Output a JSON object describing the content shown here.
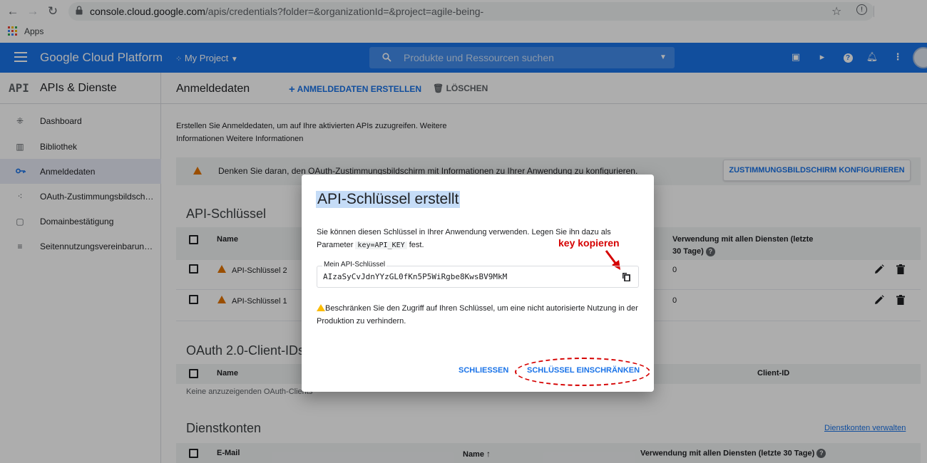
{
  "browser": {
    "url_host": "console.cloud.google.com",
    "url_rest": "/apis/credentials?folder=&organizationId=&project=agile-being-",
    "bookmarks_apps_label": "Apps"
  },
  "topbar": {
    "brand": "Google Cloud Platform",
    "project": "My Project",
    "search_placeholder": "Produkte und Ressourcen suchen"
  },
  "sidebar": {
    "logo": "API",
    "title": "APIs & Dienste",
    "items": [
      {
        "label": "Dashboard",
        "icon": "dashboard-icon"
      },
      {
        "label": "Bibliothek",
        "icon": "library-icon"
      },
      {
        "label": "Anmeldedaten",
        "icon": "key-icon",
        "active": true
      },
      {
        "label": "OAuth-Zustimmungsbildsch…",
        "icon": "consent-icon"
      },
      {
        "label": "Domainbestätigung",
        "icon": "domain-icon"
      },
      {
        "label": "Seitennutzungsvereinbarun…",
        "icon": "settings-list-icon"
      }
    ]
  },
  "main": {
    "title": "Anmeldedaten",
    "create_label": "ANMELDEDATEN ERSTELLEN",
    "delete_label": "LÖSCHEN",
    "intro": "Erstellen Sie Anmeldedaten, um auf Ihre aktivierten APIs zuzugreifen. Weitere Informationen Weitere Informationen",
    "warning": "Denken Sie daran, den OAuth-Zustimmungsbildschirm mit Informationen zu Ihrer Anwendung zu konfigurieren.",
    "consent_button": "ZUSTIMMUNGSBILDSCHIRM KONFIGURIEREN",
    "api_keys": {
      "title": "API-Schlüssel",
      "col_name": "Name",
      "col_usage": "Verwendung mit allen Diensten (letzte 30 Tage)",
      "rows": [
        {
          "name": "API-Schlüssel 2",
          "usage": "0"
        },
        {
          "name": "API-Schlüssel 1",
          "usage": "0"
        }
      ]
    },
    "oauth": {
      "title": "OAuth 2.0-Client-IDs",
      "col_name": "Name",
      "col_client": "Client-ID",
      "empty": "Keine anzuzeigenden OAuth-Clients"
    },
    "service_accounts": {
      "title": "Dienstkonten",
      "manage_link": "Dienstkonten verwalten",
      "col_email": "E-Mail",
      "col_name": "Name",
      "col_usage": "Verwendung mit allen Diensten (letzte 30 Tage)"
    }
  },
  "dialog": {
    "title": "API-Schlüssel erstellt",
    "text_before": "Sie können diesen Schlüssel in Ihrer Anwendung verwenden. Legen Sie ihn dazu als Parameter",
    "param": "key=API_KEY",
    "text_after": "fest.",
    "key_label": "Mein API-Schlüssel",
    "key_value": "AIzaSyCvJdnYYzGL0fKn5P5WiRgbe8KwsBV9MkM",
    "warning": "Beschränken Sie den Zugriff auf Ihren Schlüssel, um eine nicht autorisierte Nutzung in der Produktion zu verhindern.",
    "close_label": "SCHLIESSEN",
    "restrict_label": "SCHLÜSSEL EINSCHRÄNKEN",
    "annotation": "key kopieren",
    "annotation_color": "#d50000"
  }
}
